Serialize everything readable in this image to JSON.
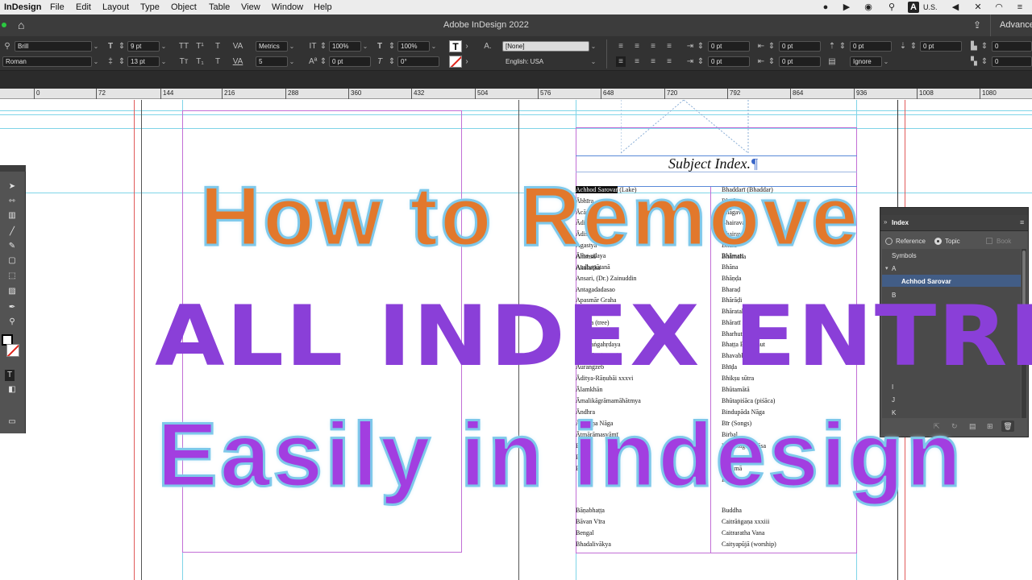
{
  "menubar": {
    "app": "InDesign",
    "items": [
      "File",
      "Edit",
      "Layout",
      "Type",
      "Object",
      "Table",
      "View",
      "Window",
      "Help"
    ],
    "input_source": "U.S."
  },
  "appbar": {
    "title": "Adobe InDesign 2022",
    "workspace": "Advance"
  },
  "control": {
    "font_family": "Brill",
    "font_style": "Roman",
    "font_size": "9 pt",
    "leading": "13 pt",
    "kerning": "Metrics",
    "tracking": "5",
    "vscale": "100%",
    "hscale": "100%",
    "baseline": "0 pt",
    "skew": "0°",
    "char_style": "[None]",
    "language": "English: USA",
    "indent_left": "0 pt",
    "indent_right": "0 pt",
    "space_before": "0 pt",
    "space_after": "0 pt",
    "first_line": "0 pt",
    "last_line": "0 pt",
    "drop_cap_lines": "0",
    "drop_cap_chars": "0",
    "hyph": "Ignore",
    "space_before2": "0 pt"
  },
  "ruler": [
    "0",
    "72",
    "144",
    "216",
    "288",
    "360",
    "432",
    "504",
    "576",
    "648",
    "720",
    "792",
    "864",
    "936",
    "1008",
    "1080"
  ],
  "page": {
    "heading": "Subject Index.",
    "heading_mark": "¶",
    "selected_entry": "Achhod Sarovar",
    "left_col": [
      "(Lake)",
      "Ābhīra",
      "Ācārya",
      "Ādi-Purāṇa",
      "Ādiśūra",
      "Agastya",
      "Ahiṁsā",
      "Akalaṅka",
      "Ālha-udaya",
      "Andhapūtanā",
      "Ansari, (Dr.) Zainuddin",
      "Antagadadasao",
      "Apasmār Graha",
      "Aphasia",
      "Arjuna (tree)",
      "Avanti",
      "Aṣṭavaṅgahṛdaya",
      "Aśvattha (Vipra)",
      "Aurangzeb",
      "Āditya-Rāṇubāi xxxvi",
      "Ālamkhān",
      "Āmalikāgrāmamāhātmya",
      "Āndhra",
      "Āpūraṇa Nāga",
      "Ātmārāmasvāmī",
      "Bāṇa",
      "Bālā",
      "Bāṇa",
      "Bāṇabhaṭṭa",
      "Bāvan Vīra",
      "Bengal",
      "Bhadalivākya"
    ],
    "right_col": [
      "Bhaddarī (Bhaddar)",
      "Bhadra",
      "Bhāgavata",
      "Bhairava",
      "Bhairavī",
      "Bhāla",
      "Bhāmaha",
      "Bhāmatī",
      "Bhāna",
      "Bhāṇḍa",
      "Bharaḍ",
      "Bhārāḍi",
      "Bhāratakā Vāyuśāstra",
      "Bhāratī",
      "Bharhut",
      "Bhaṭṭa Bhaṭṭahut",
      "Bhavabhūti",
      "Bhīḍa",
      "Bhikṣu sūtra",
      "Bhūtamātā",
      "Bhūtapiśāca (piśāca)",
      "Bindupāda Nāga",
      "Bīr (Songs)",
      "Birbal",
      "Brahmagunadāsa",
      "Brahmā",
      "Brahmāṇḍa",
      "Buddha",
      "Caitrāṅgaṇa xxxiii",
      "Caitraratha Vana",
      "Caityapūjā (worship)"
    ]
  },
  "index_panel": {
    "title": "Index",
    "mode_reference": "Reference",
    "mode_topic": "Topic",
    "book": "Book",
    "rows": [
      "Symbols",
      "A",
      "Achhod Sarovar",
      "B",
      "I",
      "J",
      "K"
    ]
  },
  "overlay": {
    "line1": "How to Remove",
    "line2": "ALL INDEX ENTRIES",
    "line3": "Easily in indesign"
  }
}
